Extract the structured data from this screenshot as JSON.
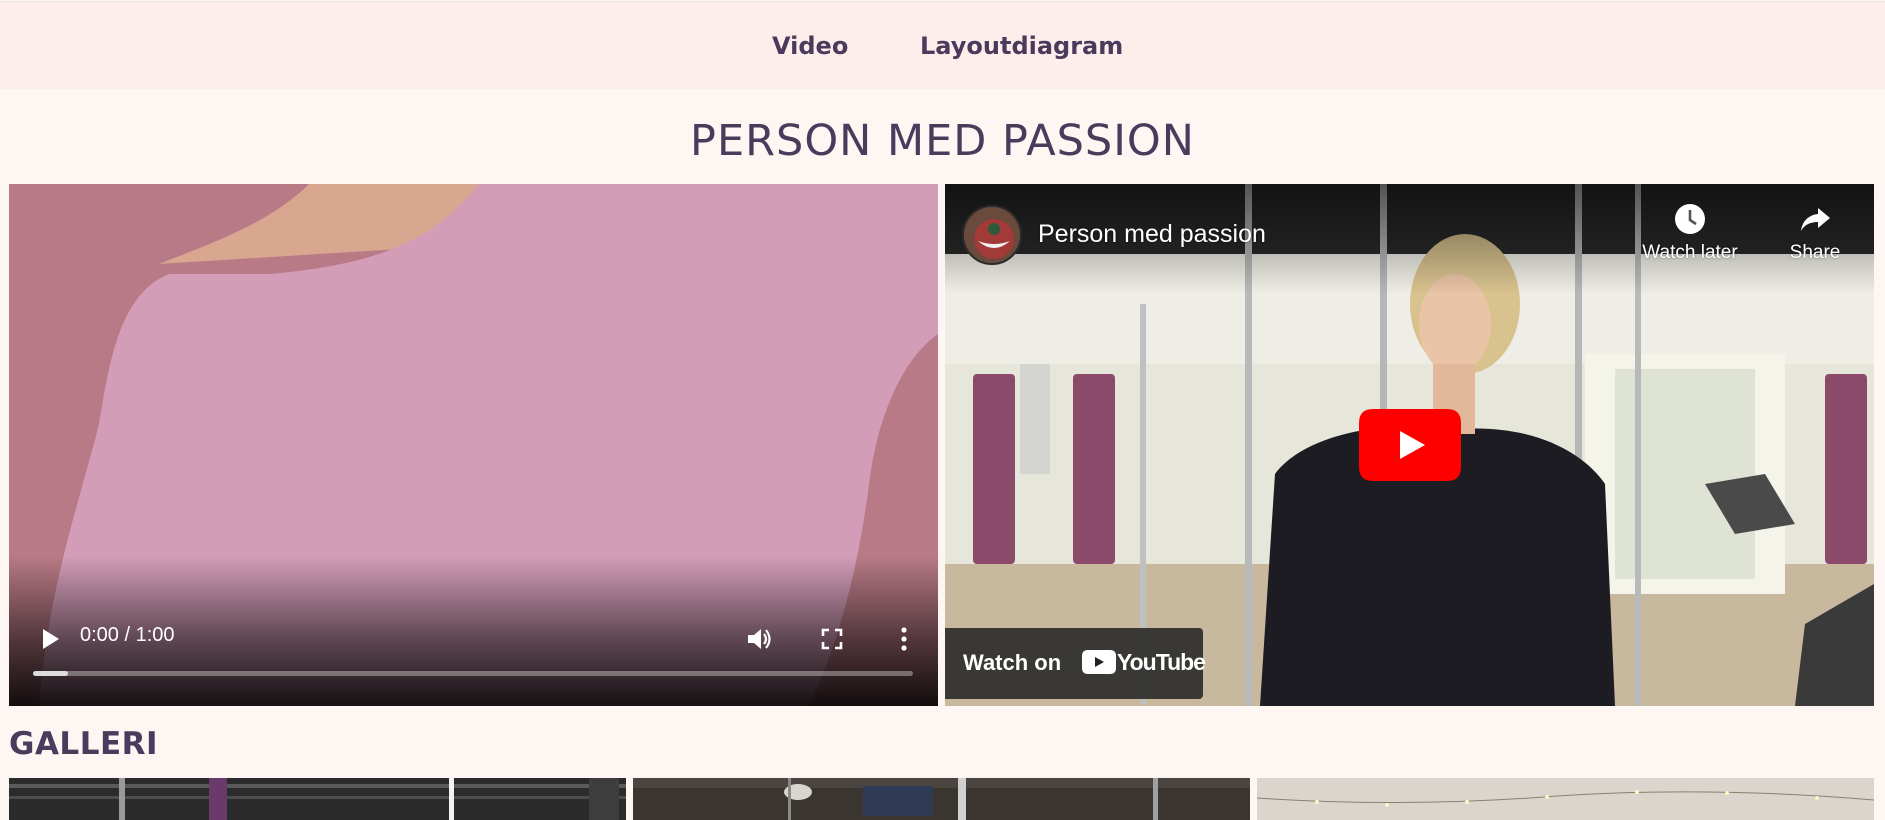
{
  "nav": {
    "items": [
      {
        "label": "Video"
      },
      {
        "label": "Layoutdiagram"
      }
    ]
  },
  "page": {
    "title": "PERSON MED PASSION"
  },
  "video_player": {
    "time": "0:00 / 1:00",
    "progress": 0.04,
    "icons": [
      "play-icon",
      "volume-icon",
      "fullscreen-icon",
      "more-options-icon"
    ]
  },
  "youtube_embed": {
    "title": "Person med passion",
    "watch_later_label": "Watch later",
    "share_label": "Share",
    "watch_on_label": "Watch on",
    "youtube_logo_text": "YouTube",
    "colors": {
      "play_button": "#ff0000"
    }
  },
  "gallery": {
    "title": "GALLERI",
    "images": 3
  },
  "colors": {
    "text": "#4a3a5c",
    "nav_bg": "#fdeeec",
    "page_bg": "#fdf6f3"
  }
}
